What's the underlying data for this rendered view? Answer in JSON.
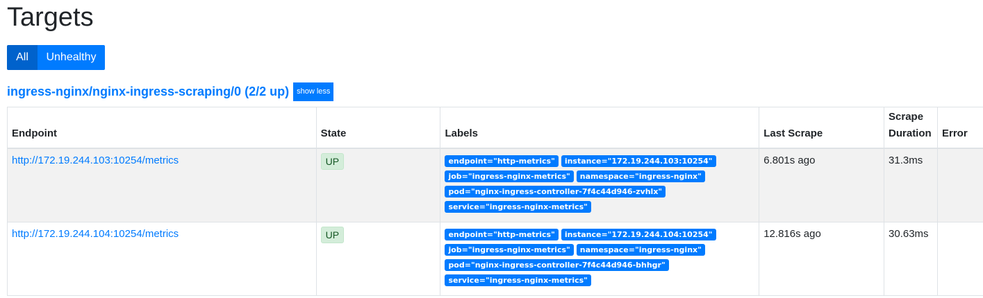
{
  "page": {
    "title": "Targets"
  },
  "filters": {
    "all_label": "All",
    "unhealthy_label": "Unhealthy",
    "active": "All"
  },
  "pool": {
    "name": "ingress-nginx/nginx-ingress-scraping/0 (2/2 up)",
    "toggle_label": "show less"
  },
  "table": {
    "headers": {
      "endpoint": "Endpoint",
      "state": "State",
      "labels": "Labels",
      "last_scrape": "Last Scrape",
      "scrape_duration_line1": "Scrape",
      "scrape_duration_line2": "Duration",
      "error": "Error"
    },
    "rows": [
      {
        "endpoint": "http://172.19.244.103:10254/metrics",
        "state": "UP",
        "labels": {
          "endpoint": "endpoint=\"http-metrics\"",
          "instance": "instance=\"172.19.244.103:10254\"",
          "job": "job=\"ingress-nginx-metrics\"",
          "namespace": "namespace=\"ingress-nginx\"",
          "pod": "pod=\"nginx-ingress-controller-7f4c44d946-zvhlx\"",
          "service": "service=\"ingress-nginx-metrics\""
        },
        "last_scrape": "6.801s ago",
        "scrape_duration": "31.3ms",
        "error": ""
      },
      {
        "endpoint": "http://172.19.244.104:10254/metrics",
        "state": "UP",
        "labels": {
          "endpoint": "endpoint=\"http-metrics\"",
          "instance": "instance=\"172.19.244.104:10254\"",
          "job": "job=\"ingress-nginx-metrics\"",
          "namespace": "namespace=\"ingress-nginx\"",
          "pod": "pod=\"nginx-ingress-controller-7f4c44d946-bhhgr\"",
          "service": "service=\"ingress-nginx-metrics\""
        },
        "last_scrape": "12.816s ago",
        "scrape_duration": "30.63ms",
        "error": ""
      }
    ]
  },
  "colors": {
    "primary": "#007bff",
    "primary_active": "#0062cc",
    "up_badge_bg": "#d4edda",
    "up_badge_text": "#155724",
    "row_stripe": "#f2f2f2"
  }
}
